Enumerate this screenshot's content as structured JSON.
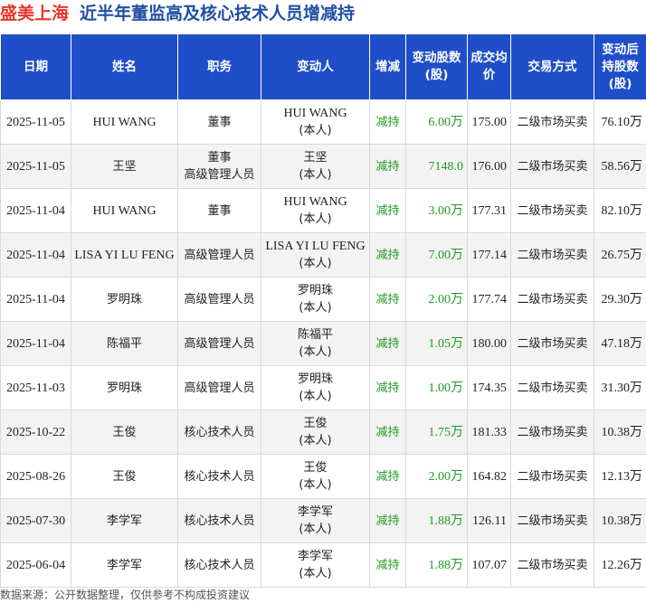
{
  "title": {
    "company": "盛美上海",
    "subject": "近半年董监高及核心技术人员增减持"
  },
  "columns": [
    "日期",
    "姓名",
    "职务",
    "变动人",
    "增减",
    "变动股数(股)",
    "成交均价",
    "交易方式",
    "变动后持股数(股)"
  ],
  "header_lines": {
    "date": [
      "日期"
    ],
    "name": [
      "姓名"
    ],
    "role": [
      "职务"
    ],
    "changer": [
      "变动人"
    ],
    "direction": [
      "增减"
    ],
    "shares": [
      "变动股数",
      "(股)"
    ],
    "price": [
      "成交",
      "均价"
    ],
    "method": [
      "交易方式"
    ],
    "holding": [
      "变动后",
      "持股数",
      "(股)"
    ]
  },
  "rows": [
    {
      "date": "2025-11-05",
      "name": "HUI WANG",
      "role": [
        "董事"
      ],
      "changer": "HUI WANG",
      "changer_tag": "(本人)",
      "direction": "减持",
      "shares": "6.00万",
      "price": "175.00",
      "method": "二级市场买卖",
      "holding": "76.10万"
    },
    {
      "date": "2025-11-05",
      "name": "王坚",
      "role": [
        "董事",
        "高级管理人员"
      ],
      "changer": "王坚",
      "changer_tag": "(本人)",
      "direction": "减持",
      "shares": "7148.0",
      "price": "176.00",
      "method": "二级市场买卖",
      "holding": "58.56万"
    },
    {
      "date": "2025-11-04",
      "name": "HUI WANG",
      "role": [
        "董事"
      ],
      "changer": "HUI WANG",
      "changer_tag": "(本人)",
      "direction": "减持",
      "shares": "3.00万",
      "price": "177.31",
      "method": "二级市场买卖",
      "holding": "82.10万"
    },
    {
      "date": "2025-11-04",
      "name": "LISA YI LU FENG",
      "role": [
        "高级管理人员"
      ],
      "changer": "LISA YI LU FENG",
      "changer_tag": "(本人)",
      "direction": "减持",
      "shares": "7.00万",
      "price": "177.14",
      "method": "二级市场买卖",
      "holding": "26.75万"
    },
    {
      "date": "2025-11-04",
      "name": "罗明珠",
      "role": [
        "高级管理人员"
      ],
      "changer": "罗明珠",
      "changer_tag": "(本人)",
      "direction": "减持",
      "shares": "2.00万",
      "price": "177.74",
      "method": "二级市场买卖",
      "holding": "29.30万"
    },
    {
      "date": "2025-11-04",
      "name": "陈福平",
      "role": [
        "高级管理人员"
      ],
      "changer": "陈福平",
      "changer_tag": "(本人)",
      "direction": "减持",
      "shares": "1.05万",
      "price": "180.00",
      "method": "二级市场买卖",
      "holding": "47.18万"
    },
    {
      "date": "2025-11-03",
      "name": "罗明珠",
      "role": [
        "高级管理人员"
      ],
      "changer": "罗明珠",
      "changer_tag": "(本人)",
      "direction": "减持",
      "shares": "1.00万",
      "price": "174.35",
      "method": "二级市场买卖",
      "holding": "31.30万"
    },
    {
      "date": "2025-10-22",
      "name": "王俊",
      "role": [
        "核心技术人员"
      ],
      "changer": "王俊",
      "changer_tag": "(本人)",
      "direction": "减持",
      "shares": "1.75万",
      "price": "181.33",
      "method": "二级市场买卖",
      "holding": "10.38万"
    },
    {
      "date": "2025-08-26",
      "name": "王俊",
      "role": [
        "核心技术人员"
      ],
      "changer": "王俊",
      "changer_tag": "(本人)",
      "direction": "减持",
      "shares": "2.00万",
      "price": "164.82",
      "method": "二级市场买卖",
      "holding": "12.13万"
    },
    {
      "date": "2025-07-30",
      "name": "李学军",
      "role": [
        "核心技术人员"
      ],
      "changer": "李学军",
      "changer_tag": "(本人)",
      "direction": "减持",
      "shares": "1.88万",
      "price": "126.11",
      "method": "二级市场买卖",
      "holding": "10.38万"
    },
    {
      "date": "2025-06-04",
      "name": "李学军",
      "role": [
        "核心技术人员"
      ],
      "changer": "李学军",
      "changer_tag": "(本人)",
      "direction": "减持",
      "shares": "1.88万",
      "price": "107.07",
      "method": "二级市场买卖",
      "holding": "12.26万"
    }
  ],
  "footer": {
    "source": "数据来源：公开数据整理，仅供参考不构成投资建议"
  },
  "colors": {
    "header_bg": "#1f4fc8",
    "company_title": "#e8362b",
    "subject_title": "#1f4fa3",
    "reduce": "#1f9b1f",
    "row_alt": "#f3f3f3"
  }
}
